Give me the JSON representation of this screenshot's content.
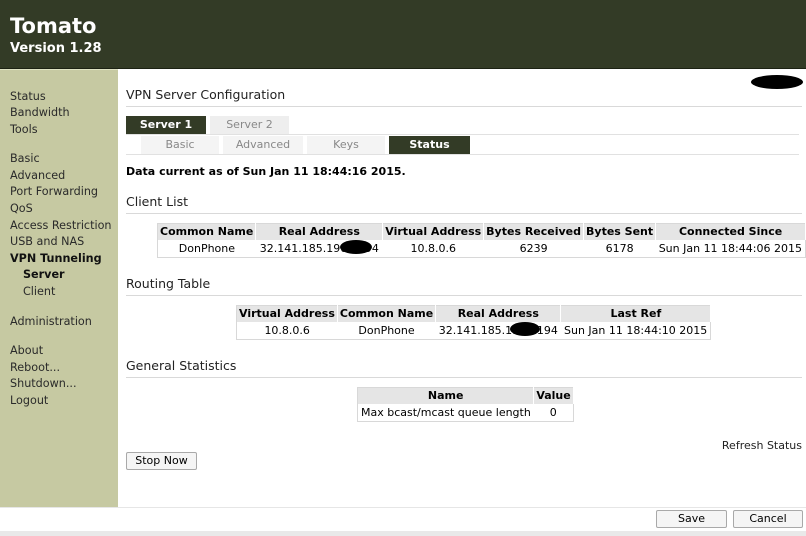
{
  "header": {
    "brand": "Tomato",
    "version": "Version 1.28"
  },
  "sidebar": {
    "items": [
      {
        "label": "Status"
      },
      {
        "label": "Bandwidth"
      },
      {
        "label": "Tools"
      },
      {
        "label": "Basic"
      },
      {
        "label": "Advanced"
      },
      {
        "label": "Port Forwarding"
      },
      {
        "label": "QoS"
      },
      {
        "label": "Access Restriction"
      },
      {
        "label": "USB and NAS"
      },
      {
        "label": "VPN Tunneling"
      },
      {
        "label": "Server"
      },
      {
        "label": "Client"
      },
      {
        "label": "Administration"
      },
      {
        "label": "About"
      },
      {
        "label": "Reboot..."
      },
      {
        "label": "Shutdown..."
      },
      {
        "label": "Logout"
      }
    ]
  },
  "page": {
    "title": "VPN Server Configuration"
  },
  "server_tabs": [
    "Server 1",
    "Server 2"
  ],
  "sub_tabs": [
    "Basic",
    "Advanced",
    "Keys",
    "Status"
  ],
  "status": {
    "data_current": "Data current as of Sun Jan 11 18:44:16 2015."
  },
  "client_list": {
    "title": "Client List",
    "headers": [
      "Common Name",
      "Real Address",
      "Virtual Address",
      "Bytes Received",
      "Bytes Sent",
      "Connected Since"
    ],
    "rows": [
      [
        "DonPhone",
        "32.141.185.190:1194",
        "10.8.0.6",
        "6239",
        "6178",
        "Sun Jan 11 18:44:06 2015"
      ]
    ]
  },
  "routing_table": {
    "title": "Routing Table",
    "headers": [
      "Virtual Address",
      "Common Name",
      "Real Address",
      "Last Ref"
    ],
    "rows": [
      [
        "10.8.0.6",
        "DonPhone",
        "32.141.185.190:1194",
        "Sun Jan 11 18:44:10 2015"
      ]
    ]
  },
  "general_stats": {
    "title": "General Statistics",
    "headers": [
      "Name",
      "Value"
    ],
    "rows": [
      [
        "Max bcast/mcast queue length",
        "0"
      ]
    ]
  },
  "actions": {
    "refresh_label": "Refresh Status",
    "stop_label": "Stop Now",
    "save_label": "Save",
    "cancel_label": "Cancel"
  },
  "colors": {
    "header_bg": "#333b26",
    "sidebar_bg": "#c6c9a2",
    "active_tab": "#333b26"
  }
}
